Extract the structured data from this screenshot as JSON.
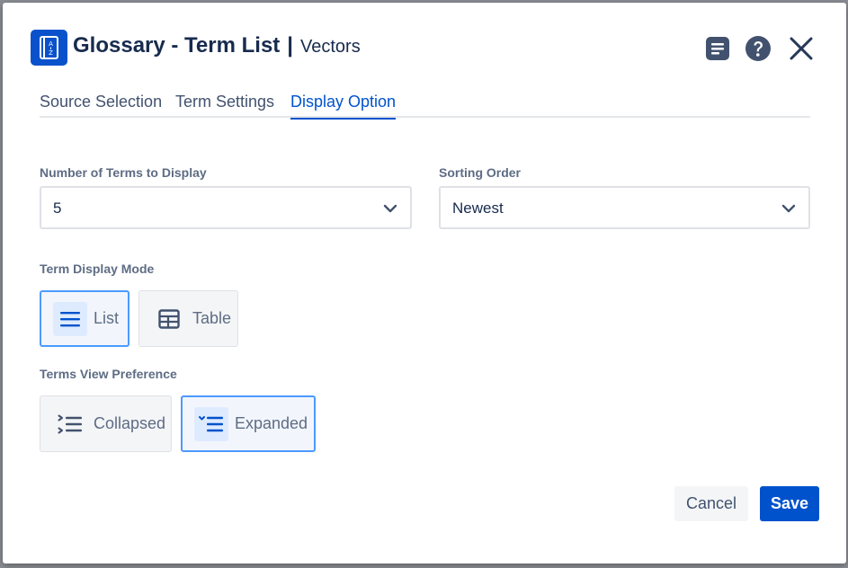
{
  "header": {
    "title": "Glossary - Term List",
    "separator": "|",
    "subtitle": "Vectors",
    "app_icon": "glossary-book-icon",
    "actions": [
      {
        "name": "notes-icon"
      },
      {
        "name": "help-icon"
      },
      {
        "name": "close-icon"
      }
    ]
  },
  "tabs": [
    {
      "label": "Source Selection",
      "active": false
    },
    {
      "label": "Term Settings",
      "active": false
    },
    {
      "label": "Display Option",
      "active": true
    }
  ],
  "fields": {
    "num_terms": {
      "label": "Number of Terms to Display",
      "value": "5"
    },
    "sorting": {
      "label": "Sorting Order",
      "value": "Newest"
    }
  },
  "display_mode": {
    "label": "Term Display Mode",
    "options": [
      {
        "label": "List",
        "icon": "list-icon",
        "selected": true
      },
      {
        "label": "Table",
        "icon": "table-icon",
        "selected": false
      }
    ]
  },
  "view_preference": {
    "label": "Terms View Preference",
    "options": [
      {
        "label": "Collapsed",
        "icon": "collapsed-list-icon",
        "selected": false
      },
      {
        "label": "Expanded",
        "icon": "expanded-list-icon",
        "selected": true
      }
    ]
  },
  "footer": {
    "cancel_label": "Cancel",
    "save_label": "Save"
  },
  "colors": {
    "accent": "#0052cc",
    "text": "#172b4d",
    "muted": "#5e6c84",
    "selected_border": "#4c9aff"
  }
}
